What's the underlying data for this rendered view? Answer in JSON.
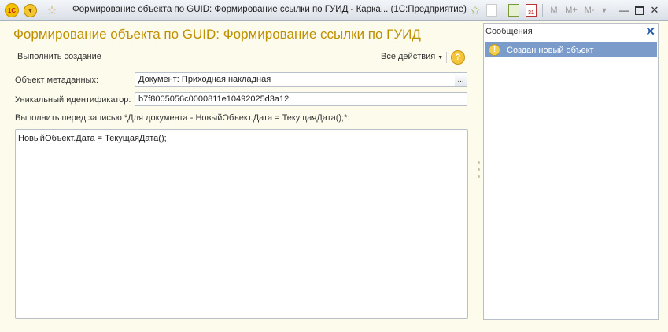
{
  "window": {
    "title": "Формирование объекта по GUID: Формирование ссылки по ГУИД - Карка...  (1С:Предприятие)",
    "toolbar_right": {
      "m": "M",
      "mplus": "M+",
      "mminus": "M-"
    }
  },
  "form": {
    "title": "Формирование объекта по GUID: Формирование ссылки по ГУИД",
    "execute_button": "Выполнить создание",
    "all_actions": "Все действия",
    "metadata_label": "Объект метаданных:",
    "metadata_value": "Документ: Приходная накладная",
    "select_button": "...",
    "guid_label": "Уникальный идентификатор:",
    "guid_value": "b7f8005056c0000811e10492025d3a12",
    "before_write_label": "Выполнить перед записью *Для документа - НовыйОбъект.Дата = ТекущаяДата();*:",
    "code": "НовыйОбъект.Дата = ТекущаяДата();"
  },
  "messages": {
    "title": "Сообщения",
    "items": [
      {
        "text": "Создан новый объект",
        "icon": "warning-icon"
      }
    ]
  }
}
